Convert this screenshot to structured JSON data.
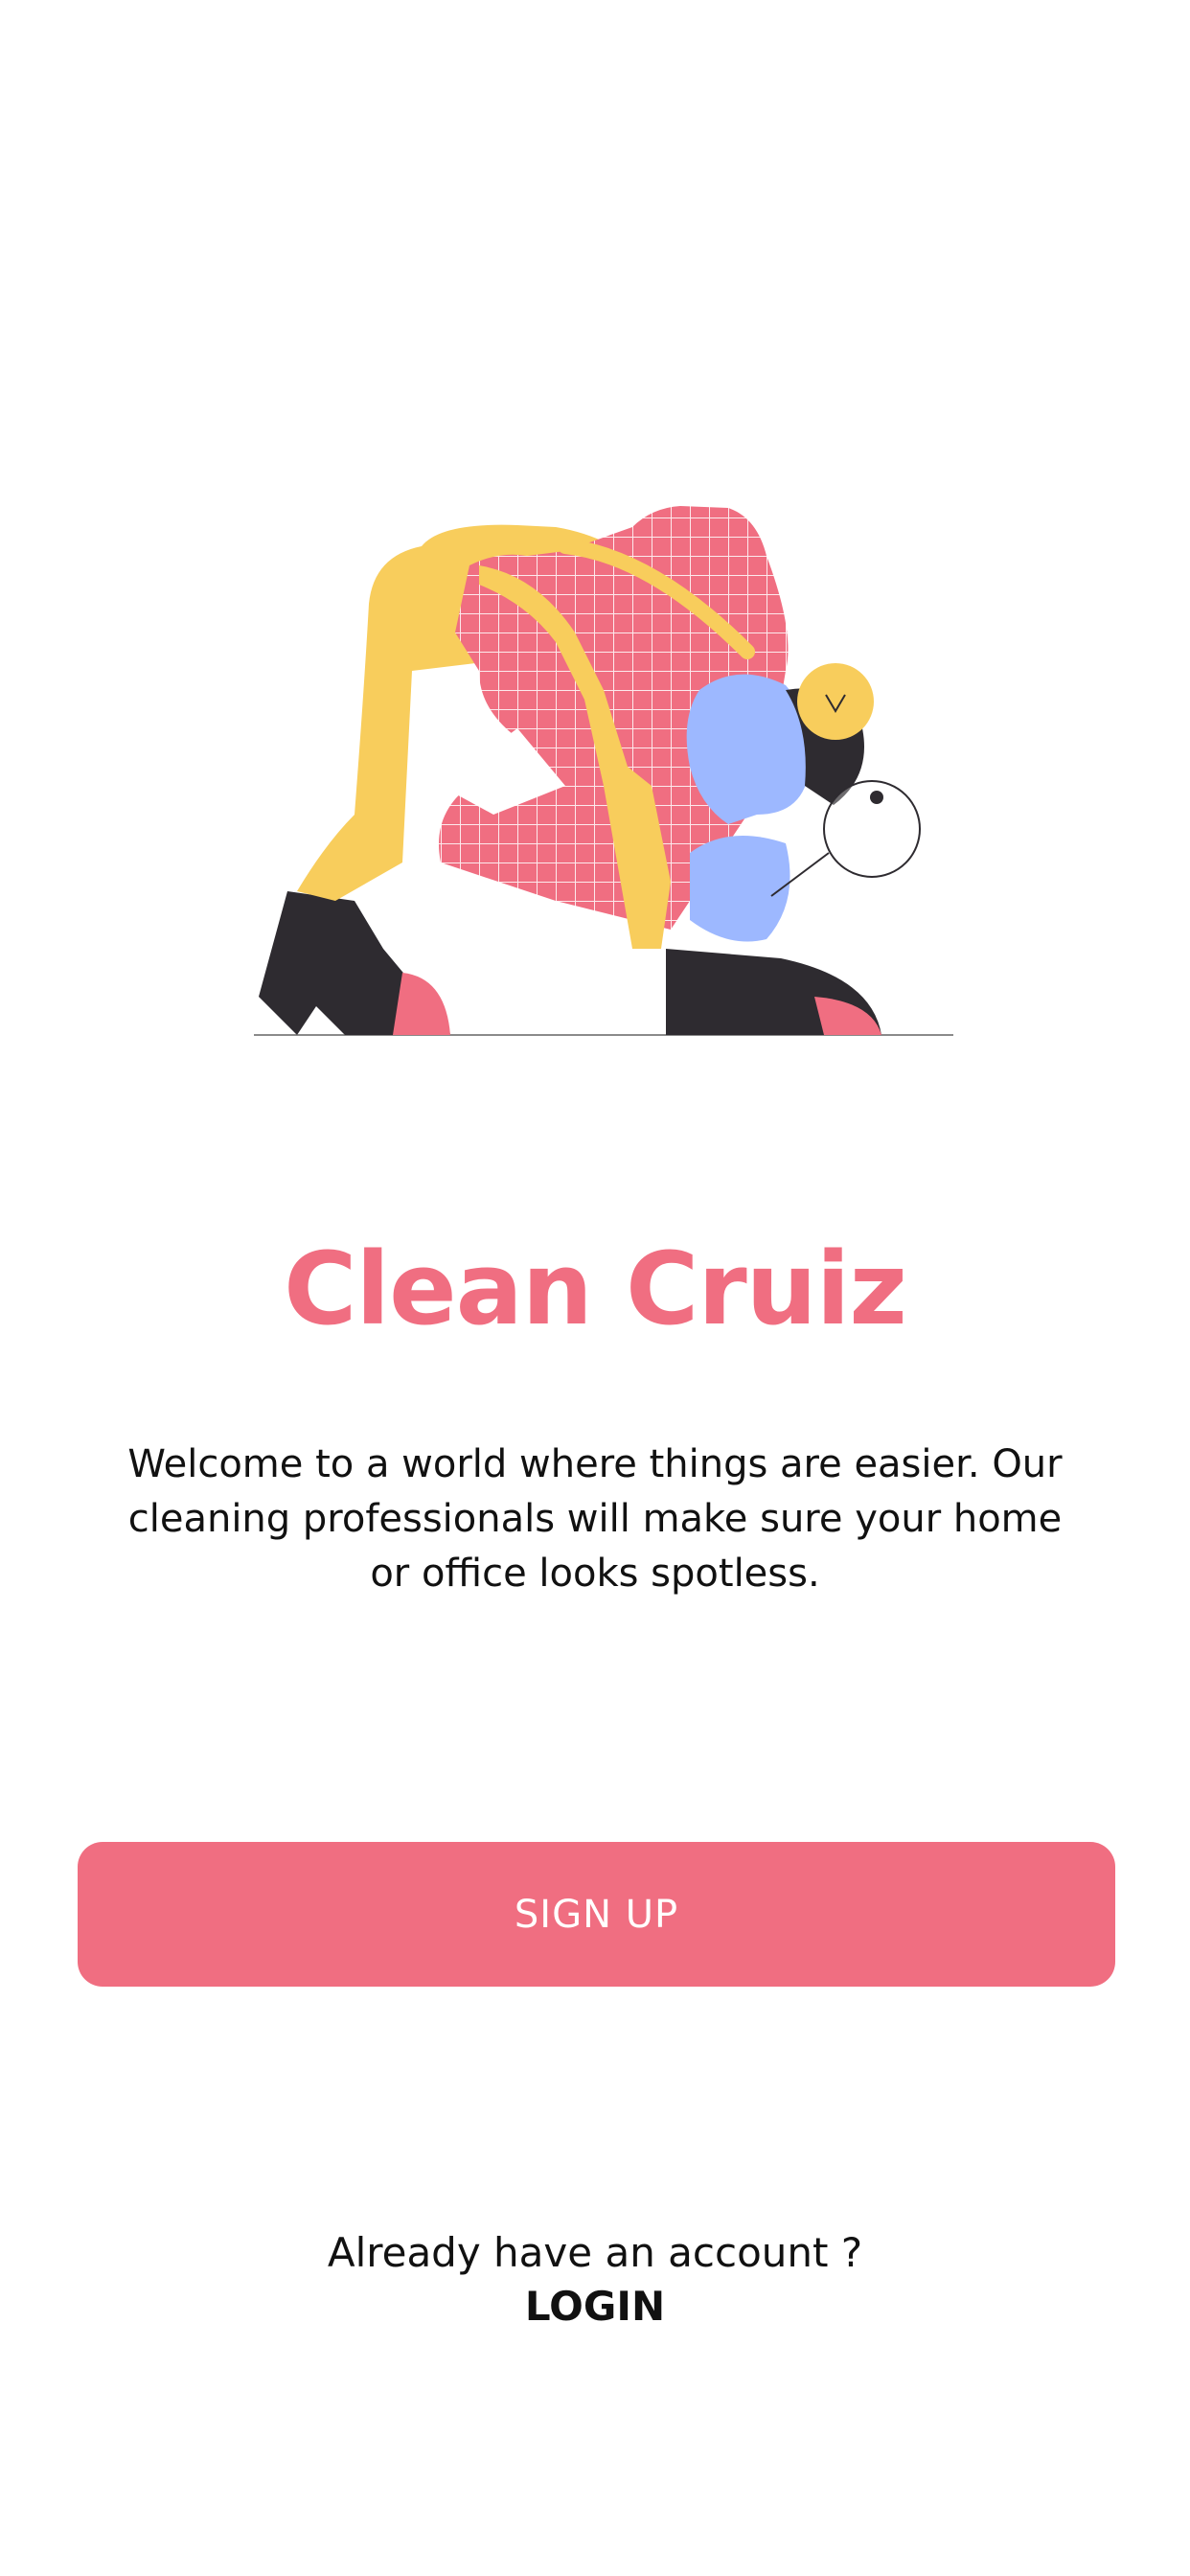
{
  "illustration": {
    "icon": "cleaning-person-illustration",
    "colors": {
      "pink": "#f06e81",
      "yellow": "#f8cd5c",
      "blue": "#9db8ff",
      "dark": "#2e2b30"
    }
  },
  "title": "Clean Cruiz",
  "description": "Welcome to a world where things are easier. Our cleaning professionals will make sure your home or office looks spotless.",
  "signup_button": {
    "label": "SIGN UP",
    "color": "#f06e81"
  },
  "login": {
    "prompt": "Already have an account ?",
    "link_label": "LOGIN"
  }
}
